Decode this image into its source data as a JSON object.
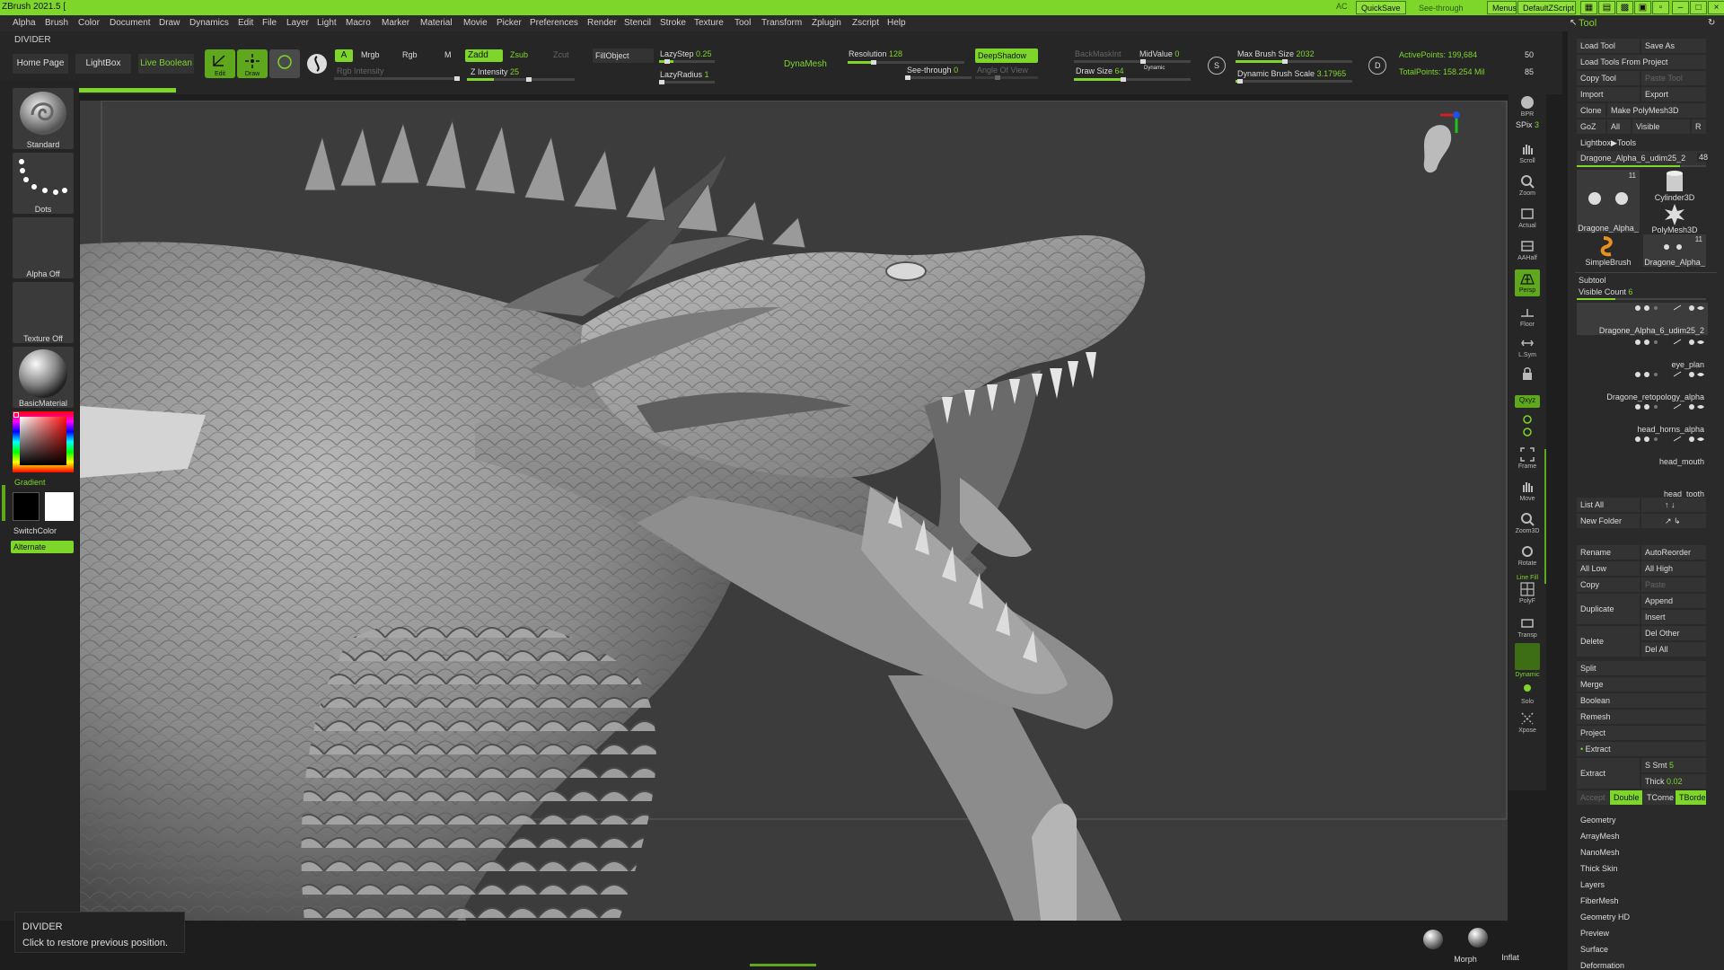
{
  "app": {
    "title": "ZBrush 2021.5 [",
    "ac_label": "AC",
    "quicksave": "QuickSave",
    "seethrough": "See-through",
    "seethrough_value": "0",
    "menus": "Menus",
    "script": "DefaultZScript"
  },
  "menu": [
    "Alpha",
    "Brush",
    "Color",
    "Document",
    "Draw",
    "Dynamics",
    "Edit",
    "File",
    "Layer",
    "Light",
    "Macro",
    "Marker",
    "Material",
    "Movie",
    "Picker",
    "Preferences",
    "Render",
    "Stencil",
    "Stroke",
    "Texture",
    "Tool",
    "Transform",
    "Zplugin",
    "Zscript",
    "Help"
  ],
  "divider_label": "DIVIDER",
  "toolbar": {
    "home_page": "Home Page",
    "lightbox": "LightBox",
    "live_boolean": "Live Boolean",
    "edit": "Edit",
    "draw": "Draw",
    "a": "A",
    "mrgb": "Mrgb",
    "rgb": "Rgb",
    "m": "M",
    "zadd": "Zadd",
    "zsub": "Zsub",
    "zcut": "Zcut",
    "fillobject": "FillObject",
    "rgb_intensity": "Rgb Intensity",
    "z_intensity": "Z Intensity",
    "z_intensity_value": "25",
    "lazystep": "LazyStep",
    "lazystep_value": "0.25",
    "lazyradius": "LazyRadius",
    "lazyradius_value": "1",
    "dynamesh": "DynaMesh",
    "resolution": "Resolution",
    "resolution_value": "128",
    "seethrough": "See-through",
    "seethrough_value": "0",
    "deepshadow": "DeepShadow",
    "angle_of_view": "Angle Of View",
    "backmaskint": "BackMaskInt",
    "midvalue": "MidValue",
    "midvalue_value": "0",
    "draw_size": "Draw Size",
    "draw_size_value": "64",
    "dynamic": "Dynamic",
    "max_brush_size": "Max Brush Size",
    "max_brush_size_value": "2032",
    "dynamic_brush_scale": "Dynamic Brush Scale",
    "dynamic_brush_scale_value": "3.17965",
    "active_points": "ActivePoints: 199,684",
    "total_points": "TotalPoints: 158.254 Mil",
    "num_a": "50",
    "num_b": "85"
  },
  "left": {
    "standard": "Standard",
    "dots": "Dots",
    "alpha_off": "Alpha Off",
    "texture_off": "Texture Off",
    "basic_material": "BasicMaterial",
    "gradient": "Gradient",
    "switchcolor": "SwitchColor",
    "alternate": "Alternate"
  },
  "right": {
    "bpr": "BPR",
    "spix": "SPix",
    "spix_value": "3",
    "scroll": "Scroll",
    "zoom": "Zoom",
    "actual": "Actual",
    "aahalf": "AAHalf",
    "persp": "Persp",
    "floor": "Floor",
    "lsym": "L.Sym",
    "qxyz": "Qxyz",
    "frame": "Frame",
    "move": "Move",
    "zoom3d": "Zoom3D",
    "rotate": "Rotate",
    "linefill": "Line Fill",
    "polyf": "PolyF",
    "transp": "Transp",
    "dynamic": "Dynamic",
    "solo": "Solo",
    "xpose": "Xpose"
  },
  "tool": {
    "header": "Tool",
    "load_tool": "Load Tool",
    "save_as": "Save As",
    "load_tools_from_project": "Load Tools From Project",
    "copy_tool": "Copy Tool",
    "paste_tool": "Paste Tool",
    "import": "Import",
    "export": "Export",
    "clone": "Clone",
    "make_polymesh": "Make PolyMesh3D",
    "goz": "GoZ",
    "all": "All",
    "visible": "Visible",
    "r": "R",
    "lightbox_tools": "Lightbox▶Tools",
    "current_tool": "Dragone_Alpha_6_udim25_2",
    "current_tool_num": "48",
    "thumbs": [
      {
        "label": "Dragone_Alpha_",
        "num": "11"
      },
      {
        "label": "Cylinder3D",
        "num": ""
      },
      {
        "label": "PolyMesh3D",
        "num": ""
      },
      {
        "label": "SimpleBrush",
        "num": ""
      },
      {
        "label": "Dragone_Alpha_",
        "num": "11"
      }
    ],
    "subtool": "Subtool",
    "visible_count": "Visible Count",
    "visible_count_value": "6",
    "subtools": [
      "Dragone_Alpha_6_udim25_2",
      "eye_plan",
      "Dragone_retopology_alpha",
      "head_horns_alpha",
      "head_mouth",
      "head_tooth"
    ],
    "list_all": "List All",
    "new_folder": "New Folder",
    "rename": "Rename",
    "autoreorder": "AutoReorder",
    "all_low": "All Low",
    "all_high": "All High",
    "copy": "Copy",
    "paste": "Paste",
    "duplicate": "Duplicate",
    "append": "Append",
    "insert": "Insert",
    "delete": "Delete",
    "del_other": "Del Other",
    "del_all": "Del All",
    "split": "Split",
    "merge": "Merge",
    "boolean": "Boolean",
    "remesh": "Remesh",
    "project": "Project",
    "extract_header": "Extract",
    "extract": "Extract",
    "s_smt": "S Smt",
    "s_smt_value": "5",
    "thick": "Thick",
    "thick_value": "0.02",
    "accept": "Accept",
    "double": "Double",
    "tcorne": "TCorne",
    "tborde": "TBorde",
    "menu_items": [
      "Geometry",
      "ArrayMesh",
      "NanoMesh",
      "Thick Skin",
      "Layers",
      "FiberMesh",
      "Geometry HD",
      "Preview",
      "Surface",
      "Deformation"
    ]
  },
  "tooltip": {
    "title": "DIVIDER",
    "text": "Click to restore previous position."
  },
  "bottom": {
    "morph": "Morph",
    "inflat": "Inflat"
  },
  "colors": {
    "accent": "#7ed62a",
    "panel": "#2a2a2a",
    "viewport": "#3c3c3c"
  }
}
